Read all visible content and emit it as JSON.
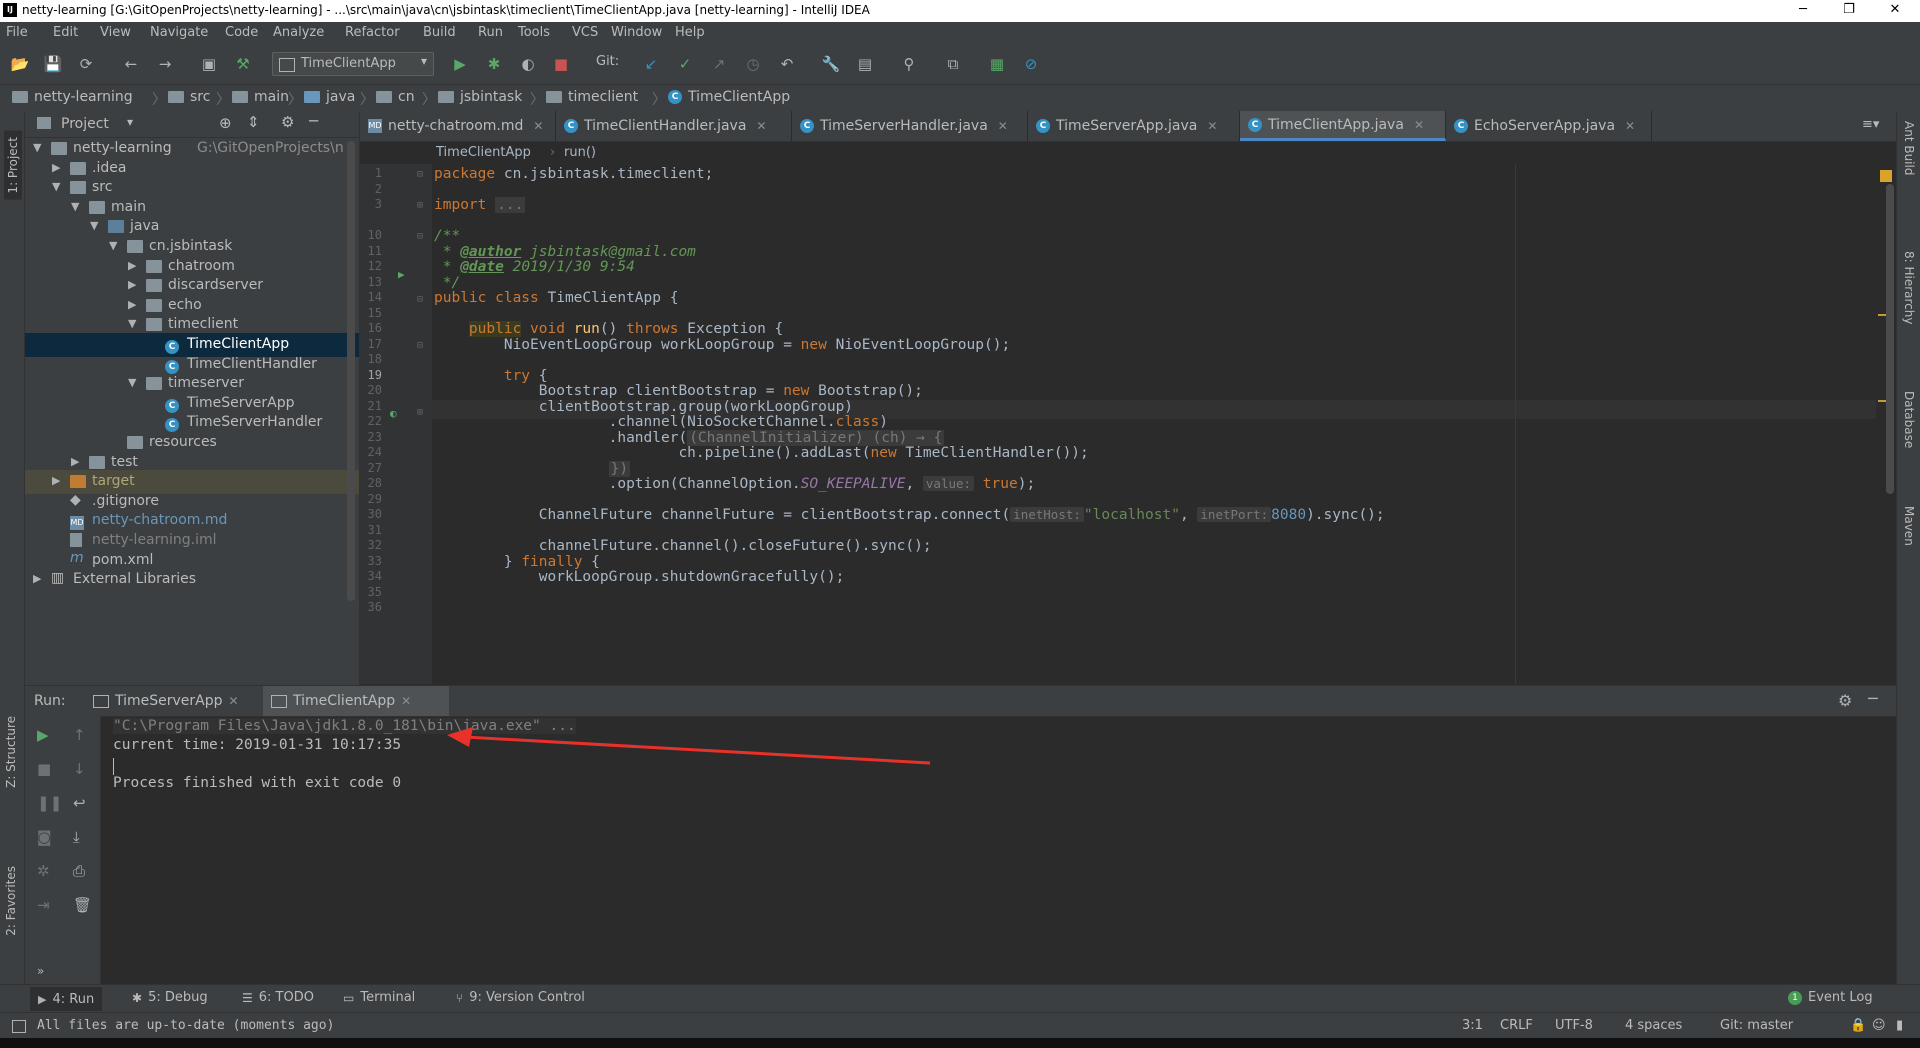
{
  "window": {
    "title": "netty-learning [G:\\GitOpenProjects\\netty-learning] - ...\\src\\main\\java\\cn\\jsbintask\\timeclient\\TimeClientApp.java [netty-learning] - IntelliJ IDEA",
    "logo": "IJ",
    "minimize": "─",
    "maximize": "❐",
    "close": "✕"
  },
  "menu": [
    "File",
    "Edit",
    "View",
    "Navigate",
    "Code",
    "Analyze",
    "Refactor",
    "Build",
    "Run",
    "Tools",
    "VCS",
    "Window",
    "Help"
  ],
  "toolbar": {
    "run_config": "TimeClientApp",
    "git_label": "Git:"
  },
  "breadcrumb": [
    "netty-learning",
    "src",
    "main",
    "java",
    "cn",
    "jsbintask",
    "timeclient",
    "TimeClientApp"
  ],
  "left_strip": {
    "project_tab": "1: Project",
    "structure_tab": "Z: Structure",
    "favorites_tab": "2: Favorites"
  },
  "right_strip": {
    "ant": "Ant Build",
    "hierarchy": "8: Hierarchy",
    "database": "Database",
    "maven": "Maven"
  },
  "project": {
    "header": "Project",
    "tree": [
      {
        "label": "netty-learning",
        "suffix": "G:\\GitOpenProjects\\n"
      },
      {
        "label": ".idea"
      },
      {
        "label": "src"
      },
      {
        "label": "main"
      },
      {
        "label": "java"
      },
      {
        "label": "cn.jsbintask"
      },
      {
        "label": "chatroom"
      },
      {
        "label": "discardserver"
      },
      {
        "label": "echo"
      },
      {
        "label": "timeclient"
      },
      {
        "label": "TimeClientApp"
      },
      {
        "label": "TimeClientHandler"
      },
      {
        "label": "timeserver"
      },
      {
        "label": "TimeServerApp"
      },
      {
        "label": "TimeServerHandler"
      },
      {
        "label": "resources"
      },
      {
        "label": "test"
      },
      {
        "label": "target"
      },
      {
        "label": ".gitignore"
      },
      {
        "label": "netty-chatroom.md"
      },
      {
        "label": "netty-learning.iml"
      },
      {
        "label": "pom.xml"
      },
      {
        "label": "External Libraries"
      }
    ]
  },
  "tabs": [
    "netty-chatroom.md",
    "TimeClientHandler.java",
    "TimeServerHandler.java",
    "TimeServerApp.java",
    "TimeClientApp.java",
    "EchoServerApp.java"
  ],
  "editor": {
    "crumb_class": "TimeClientApp",
    "crumb_method": "run()",
    "line_numbers": [
      "1",
      "2",
      "3",
      "10",
      "11",
      "12",
      "13",
      "14",
      "15",
      "16",
      "17",
      "18",
      "19",
      "20",
      "21",
      "22",
      "23",
      "24",
      "27",
      "28",
      "29",
      "30",
      "31",
      "32",
      "33",
      "34",
      "35",
      "36"
    ],
    "code": {
      "l1_kw": "package",
      "l1_rest": " cn.jsbintask.timeclient;",
      "l3_kw": "import",
      "l3_fold": "...",
      "l11": "/**",
      "l12_pre": " * ",
      "l12_tag": "@author",
      "l12_rest": " jsbintask@gmail.com",
      "l13_pre": " * ",
      "l13_tag": "@date",
      "l13_rest": " 2019/1/30 9:54",
      "l14": " */",
      "l15_kw": "public class",
      "l15_rest": " TimeClientApp {",
      "l17_pub": "public",
      "l17_void": " void ",
      "l17_fn": "run",
      "l17_mid": "() ",
      "l17_throws": "throws",
      "l17_rest": " Exception {",
      "l18_a": "NioEventLoopGroup workLoopGroup = ",
      "l18_new": "new",
      "l18_b": " NioEventLoopGroup();",
      "l20_kw": "try",
      "l20_rest": " {",
      "l21_a": "Bootstrap clientBootstrap = ",
      "l21_new": "new",
      "l21_b": " Bootstrap();",
      "l22": "clientBootstrap.group(workLoopGroup)",
      "l23_a": ".channel(NioSocketChannel.",
      "l23_kw": "class",
      "l23_b": ")",
      "l24_a": ".handler(",
      "l24_fold": "(ChannelInitializer) (ch) → {",
      "l27_a": "ch.pipeline().addLast(",
      "l27_new": "new",
      "l27_b": " TimeClientHandler());",
      "l28_fold": "})",
      "l30_a": ".option(ChannelOption.",
      "l30_const": "SO_KEEPALIVE",
      "l30_b": ", ",
      "l30_hint": "value:",
      "l30_val": "true",
      "l30_c": ");",
      "l32_a": "ChannelFuture channelFuture = clientBootstrap.connect(",
      "l32_hint1": "inetHost:",
      "l32_str": "\"localhost\"",
      "l32_b": ", ",
      "l32_hint2": "inetPort:",
      "l32_num": "8080",
      "l32_c": ").sync();",
      "l34": "channelFuture.channel().closeFuture().sync();",
      "l35_a": "} ",
      "l35_kw": "finally",
      "l35_b": " {",
      "l36": "workLoopGroup.shutdownGracefully();"
    }
  },
  "run": {
    "label": "Run:",
    "tabs": [
      "TimeServerApp",
      "TimeClientApp"
    ],
    "console": [
      "\"C:\\Program Files\\Java\\jdk1.8.0_181\\bin\\java.exe\" ...",
      "current time: 2019-01-31 10:17:35",
      "",
      "Process finished with exit code 0"
    ],
    "arrow_color": "#e8312a"
  },
  "bottom_tabs": [
    "4: Run",
    "5: Debug",
    "6: TODO",
    "Terminal",
    "9: Version Control",
    "Event Log"
  ],
  "event_log_count": "1",
  "status": {
    "message": "All files are up-to-date (moments ago)",
    "position": "3:1",
    "line_sep": "CRLF",
    "encoding": "UTF-8",
    "indent": "4 spaces",
    "git": "Git: master"
  }
}
